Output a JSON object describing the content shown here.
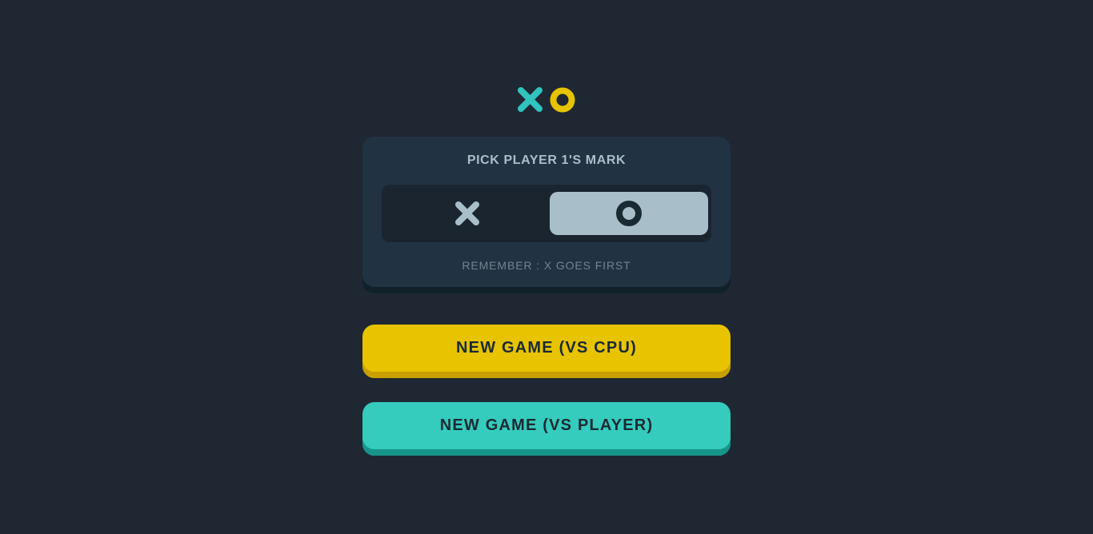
{
  "logo": {
    "icons": [
      "x-mark-icon",
      "o-mark-icon"
    ],
    "colors": {
      "x": "#31c3bd",
      "o": "#f2b137"
    }
  },
  "picker": {
    "title": "PICK PLAYER 1'S MARK",
    "options": [
      {
        "icon": "x-mark-icon",
        "selected": false
      },
      {
        "icon": "o-mark-icon",
        "selected": true
      }
    ],
    "note": "REMEMBER : X GOES FIRST"
  },
  "buttons": {
    "vs_cpu": "NEW GAME (VS CPU)",
    "vs_player": "NEW GAME (VS PLAYER)"
  },
  "colors": {
    "background": "#1f2733",
    "card": "#213243",
    "accent_yellow": "#e7c300",
    "accent_teal": "#35cbbd",
    "silver": "#a8bfc9"
  }
}
